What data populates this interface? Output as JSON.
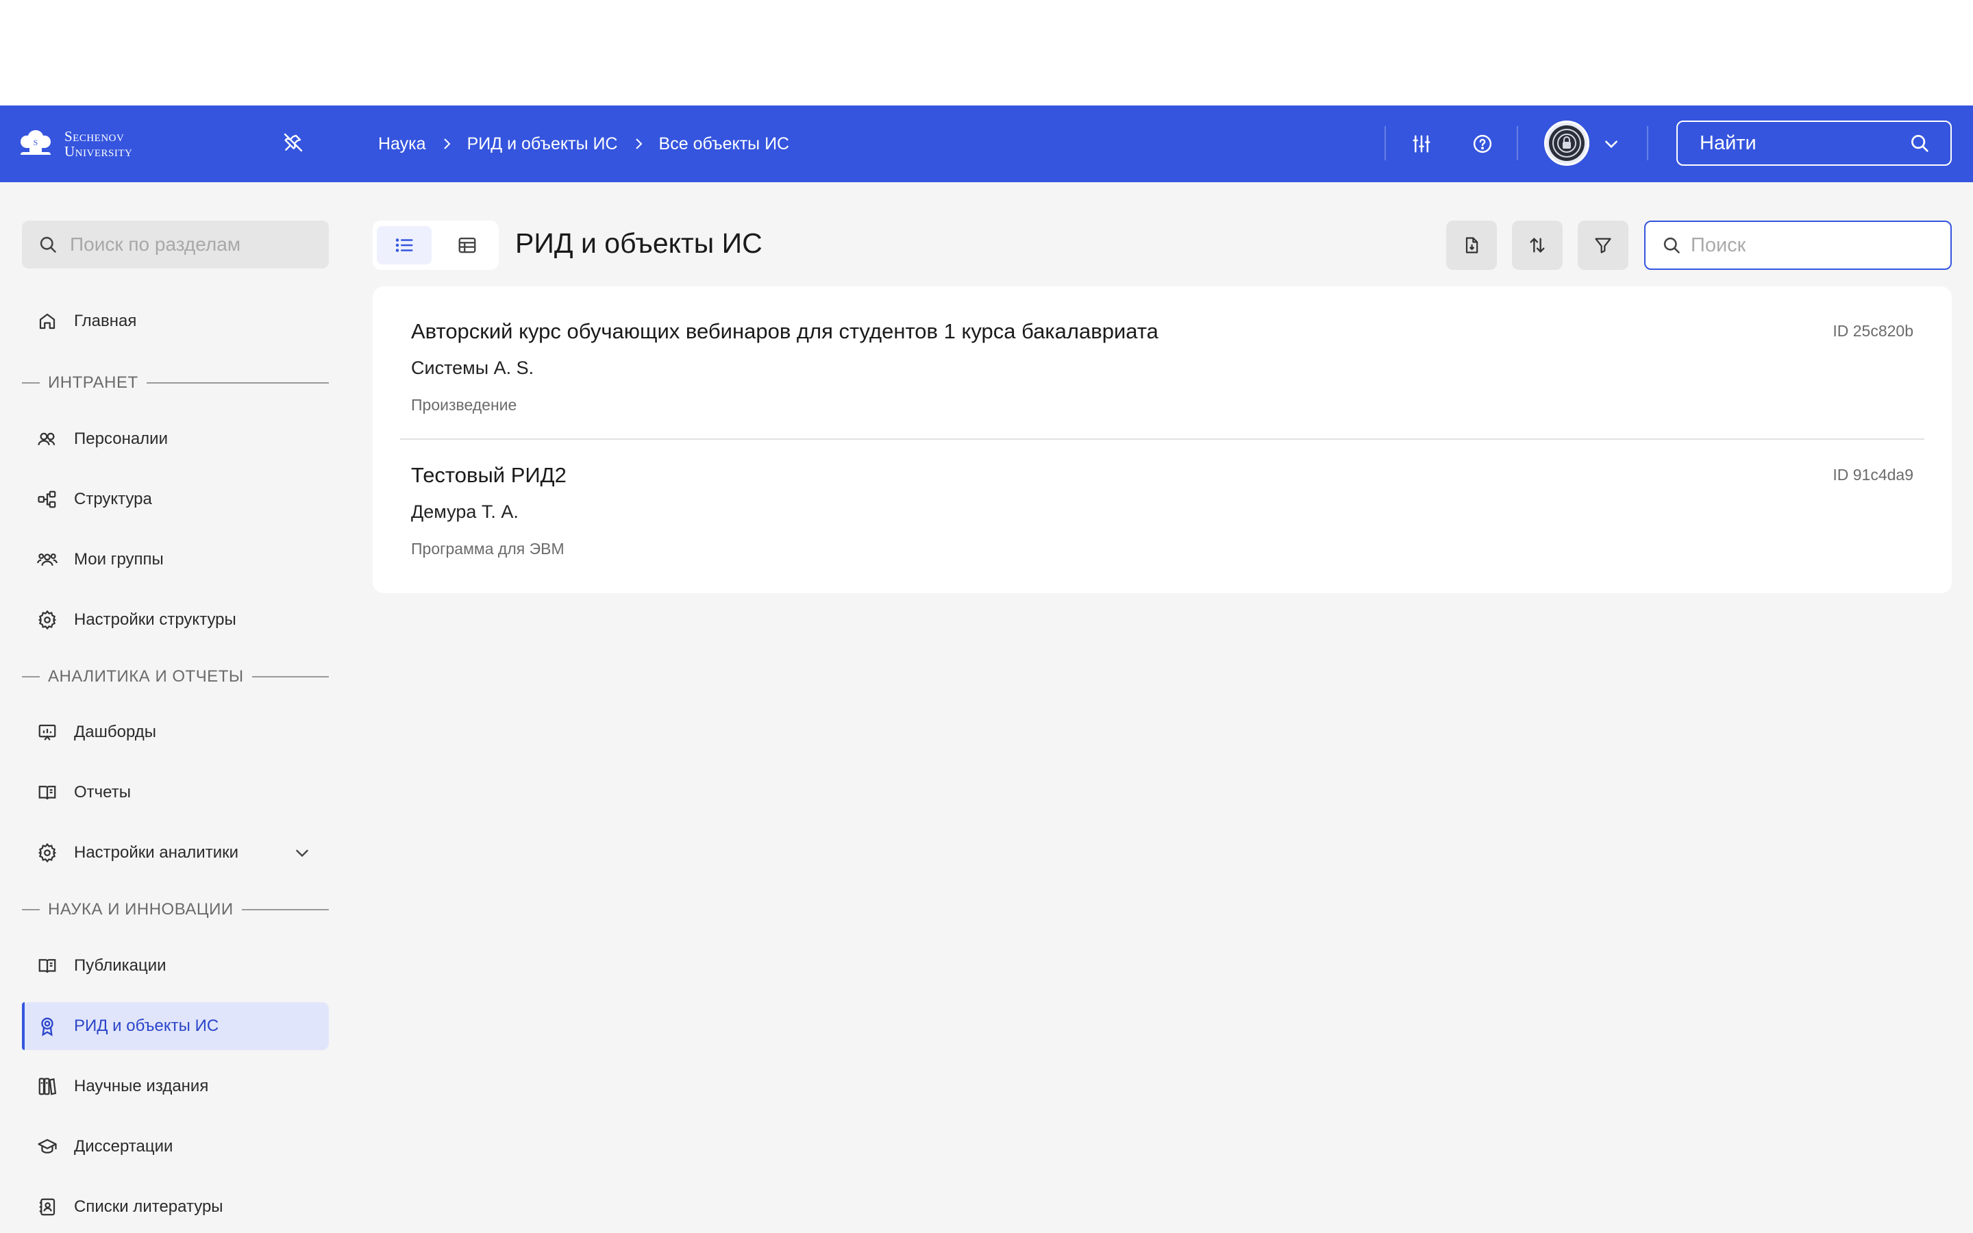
{
  "header": {
    "logo_line1": "Sechenov",
    "logo_line2": "University",
    "breadcrumbs": [
      "Наука",
      "РИД и объекты ИС",
      "Все объекты ИС"
    ],
    "search_label": "Найти"
  },
  "sidebar": {
    "search_placeholder": "Поиск по разделам",
    "home_label": "Главная",
    "sections": {
      "intranet": "ИНТРАНЕТ",
      "analytics": "АНАЛИТИКА И ОТЧЕТЫ",
      "science": "НАУКА И ИННОВАЦИИ"
    },
    "items": {
      "persons": "Персоналии",
      "structure": "Структура",
      "my_groups": "Мои группы",
      "structure_settings": "Настройки структуры",
      "dashboards": "Дашборды",
      "reports": "Отчеты",
      "analytics_settings": "Настройки аналитики",
      "publications": "Публикации",
      "rid": "РИД и объекты ИС",
      "sci_editions": "Научные издания",
      "dissertations": "Диссертации",
      "literature": "Списки литературы"
    }
  },
  "main": {
    "title": "РИД и объекты ИС",
    "search_placeholder": "Поиск",
    "records": [
      {
        "title": "Авторский курс обучающих вебинаров для студентов 1 курса бакалавриата",
        "author": "Системы А. S.",
        "type": "Произведение",
        "id": "ID 25c820b"
      },
      {
        "title": "Тестовый РИД2",
        "author": "Демура Т. А.",
        "type": "Программа для ЭВМ",
        "id": "ID 91c4da9"
      }
    ]
  },
  "colors": {
    "brand": "#3555de",
    "active_bg": "#e1e5fb",
    "page_bg": "#f5f5f5"
  }
}
